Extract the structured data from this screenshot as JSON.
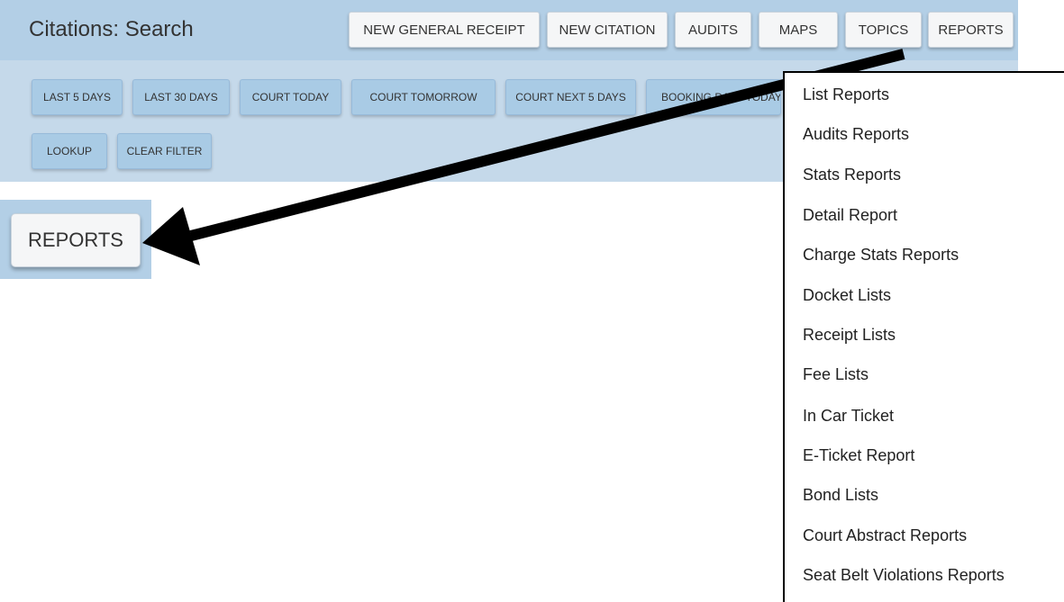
{
  "header": {
    "title": "Citations: Search",
    "buttons": [
      "NEW GENERAL RECEIPT",
      "NEW CITATION",
      "AUDITS",
      "MAPS",
      "TOPICS",
      "REPORTS"
    ]
  },
  "filters": {
    "row1": [
      "LAST 5 DAYS",
      "LAST 30 DAYS",
      "COURT TODAY",
      "COURT TOMORROW",
      "COURT NEXT 5 DAYS",
      "BOOKING DATE TODAY"
    ],
    "row2": [
      "LOOKUP",
      "CLEAR FILTER"
    ]
  },
  "zoom_callout": {
    "label": "REPORTS"
  },
  "reports_menu": {
    "items": [
      "List Reports",
      "Audits Reports",
      "Stats Reports",
      "Detail Report",
      "Charge Stats Reports",
      "Docket Lists",
      "Receipt Lists",
      "Fee Lists",
      "In Car Ticket",
      "E-Ticket Report",
      "Bond Lists",
      "Court Abstract Reports",
      "Seat Belt Violations Reports"
    ]
  },
  "colors": {
    "header_bg": "#b3cfe6",
    "filterbar_bg": "#c5d9ea",
    "filter_button_bg": "#a9cbe5",
    "arrow": "#000000"
  }
}
